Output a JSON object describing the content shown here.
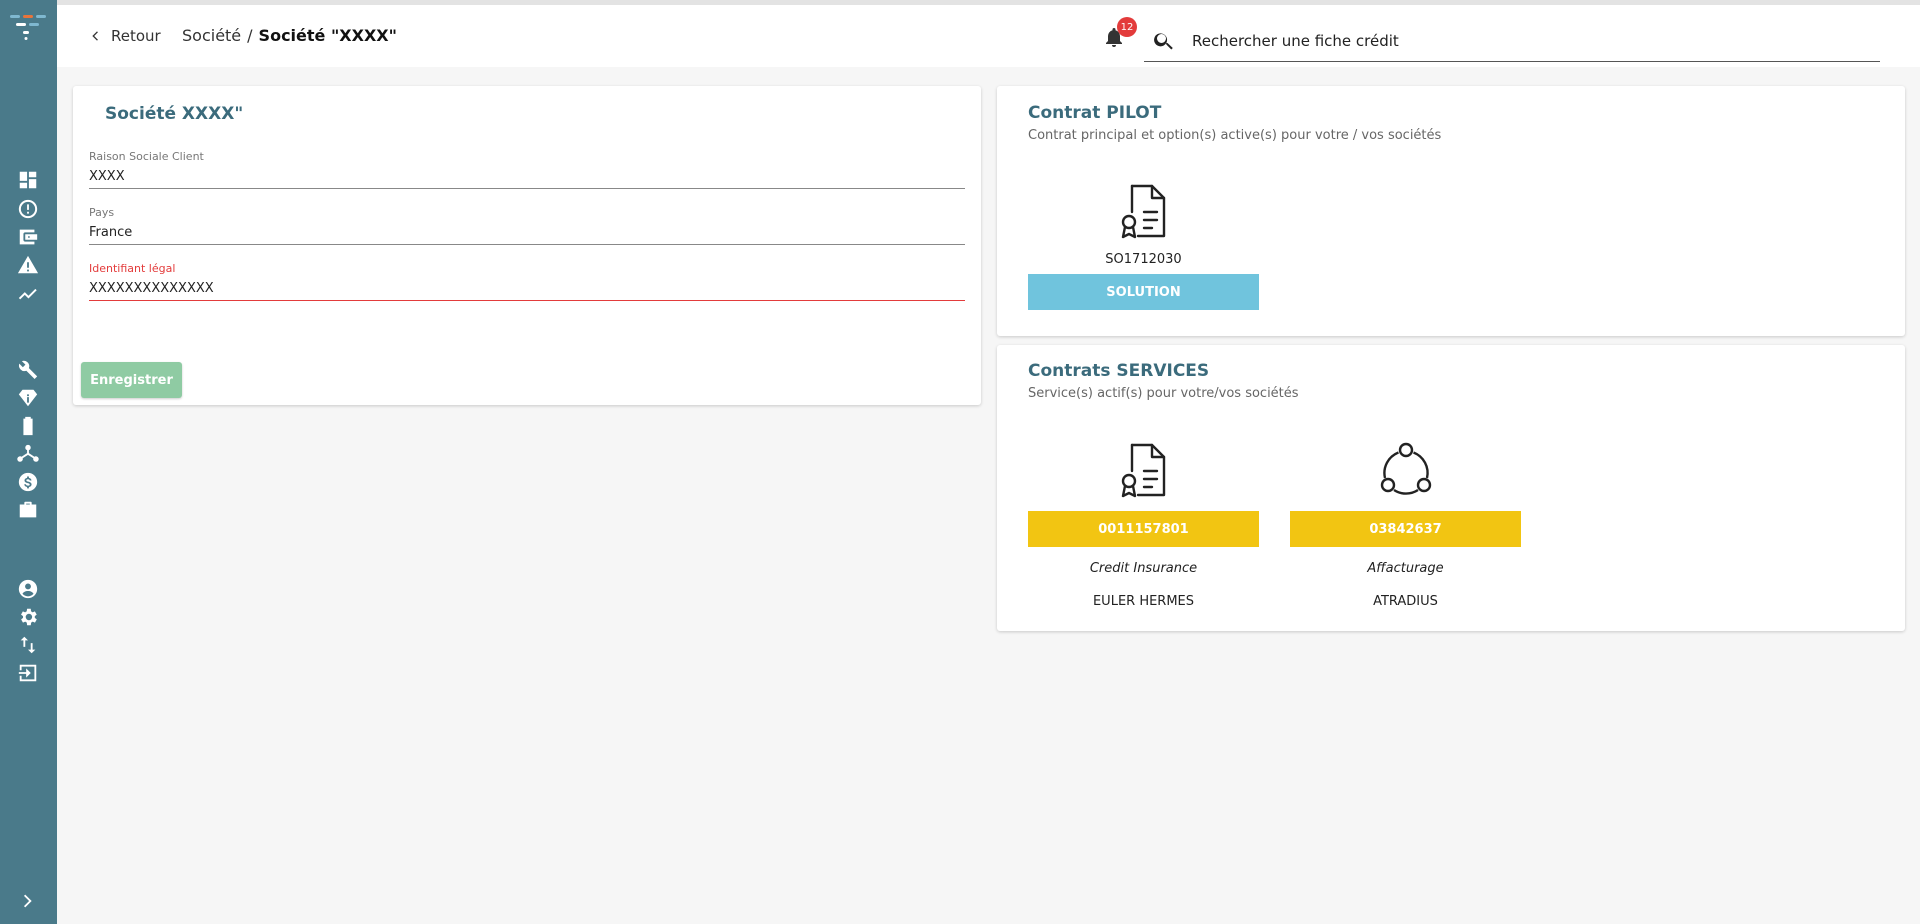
{
  "header": {
    "back_label": "Retour",
    "breadcrumb_parent": "Société",
    "breadcrumb_separator": "/",
    "breadcrumb_current": "Société \"XXXX\"",
    "notifications_count": "12",
    "search_placeholder": "Rechercher une fiche crédit"
  },
  "sidebar": {
    "icons": [
      "dashboard-icon",
      "alert-circle-icon",
      "wallet-icon",
      "warning-icon",
      "trend-icon",
      "wrench-icon",
      "diamond-info-icon",
      "battery-icon",
      "network-icon",
      "dollar-icon",
      "briefcase-icon",
      "account-icon",
      "settings-icon",
      "swap-icon",
      "logout-icon",
      "chevron-right-icon"
    ]
  },
  "company_card": {
    "title": "Société XXXX\"",
    "fields": [
      {
        "label": "Raison Sociale Client",
        "value": "XXXX"
      },
      {
        "label": "Pays",
        "value": "France"
      },
      {
        "label": "Identifiant légal",
        "value": "XXXXXXXXXXXXXX"
      }
    ],
    "save_label": "Enregistrer"
  },
  "pilot_card": {
    "title": "Contrat PILOT",
    "subtitle": "Contrat principal et option(s) active(s) pour votre / vos sociétés",
    "contract_code": "SO1712030",
    "contract_label": "SOLUTION"
  },
  "services_card": {
    "title": "Contrats SERVICES",
    "subtitle": "Service(s) actif(s) pour votre/vos sociétés",
    "contracts": [
      {
        "number": "0011157801",
        "type": "Credit Insurance",
        "provider": "EULER HERMES"
      },
      {
        "number": "03842637",
        "type": "Affacturage",
        "provider": "ATRADIUS"
      }
    ]
  },
  "colors": {
    "sidebar": "#4a7a8a",
    "title": "#3b6b7c",
    "pilot_bar": "#70c4dd",
    "service_bar": "#f2c512",
    "save_button": "#8fcba3",
    "error": "#e33b3b"
  }
}
